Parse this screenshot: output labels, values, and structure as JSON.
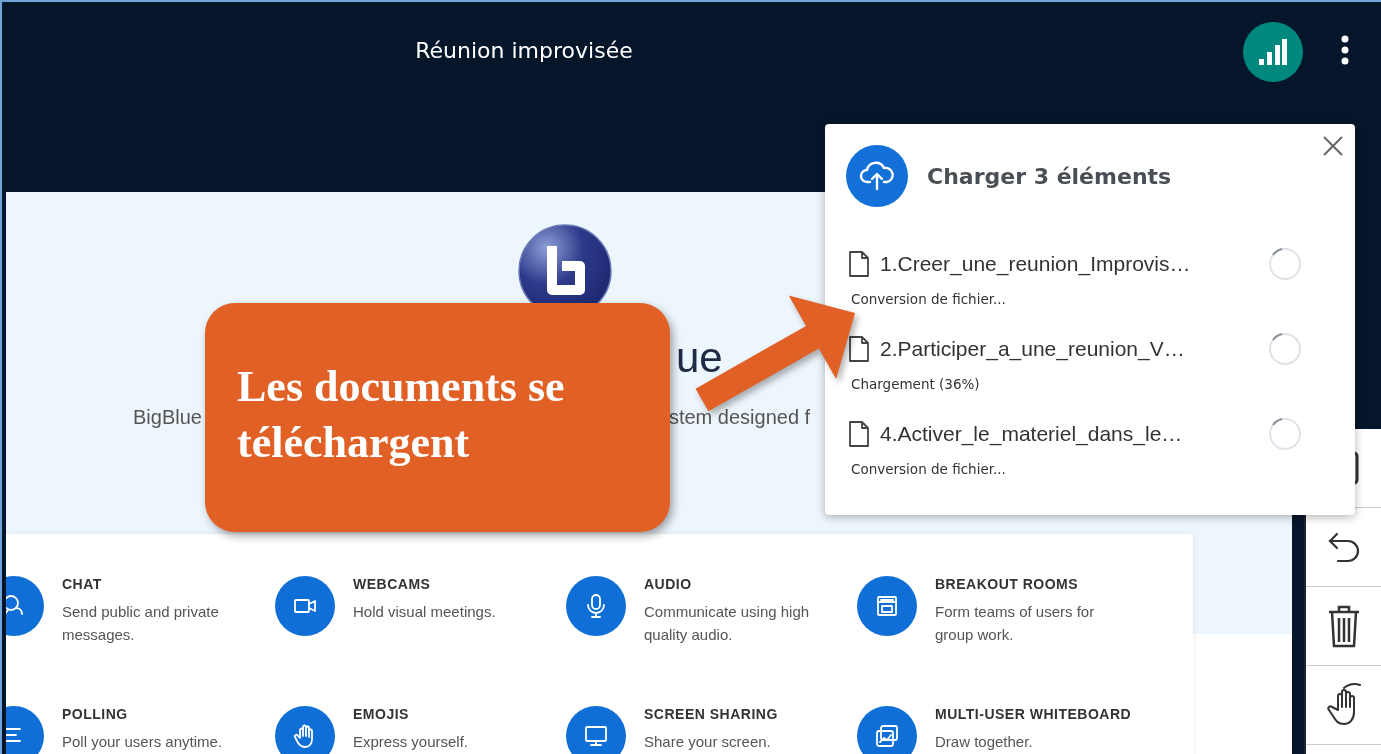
{
  "meeting": {
    "title": "Réunion improvisée"
  },
  "hero": {
    "heading_fragments": [
      "ue"
    ],
    "subtitle_fragments": [
      "BigBlue",
      "stem designed f"
    ]
  },
  "features": [
    {
      "kind": "chat",
      "title": "CHAT",
      "description": "Send public and private messages."
    },
    {
      "kind": "webcam",
      "title": "WEBCAMS",
      "description": "Hold visual meetings."
    },
    {
      "kind": "audio",
      "title": "AUDIO",
      "description": "Communicate using high quality audio."
    },
    {
      "kind": "breakout",
      "title": "BREAKOUT ROOMS",
      "description": "Form teams of users for group work."
    },
    {
      "kind": "polling",
      "title": "POLLING",
      "description": "Poll your users anytime."
    },
    {
      "kind": "emoji",
      "title": "EMOJIS",
      "description": "Express yourself."
    },
    {
      "kind": "screen",
      "title": "SCREEN SHARING",
      "description": "Share your screen."
    },
    {
      "kind": "whiteboard",
      "title": "MULTI-USER WHITEBOARD",
      "description": "Draw together."
    }
  ],
  "upload_dialog": {
    "title": "Charger 3 éléments",
    "items": [
      {
        "filename": "1.Creer_une_reunion_Improvis…",
        "status": "Conversion de fichier..."
      },
      {
        "filename": "2.Participer_a_une_reunion_V…",
        "status": "Chargement (36%)"
      },
      {
        "filename": "4.Activer_le_materiel_dans_le…",
        "status": "Conversion de fichier..."
      }
    ]
  },
  "callout": {
    "text": "Les documents se téléchargent"
  }
}
